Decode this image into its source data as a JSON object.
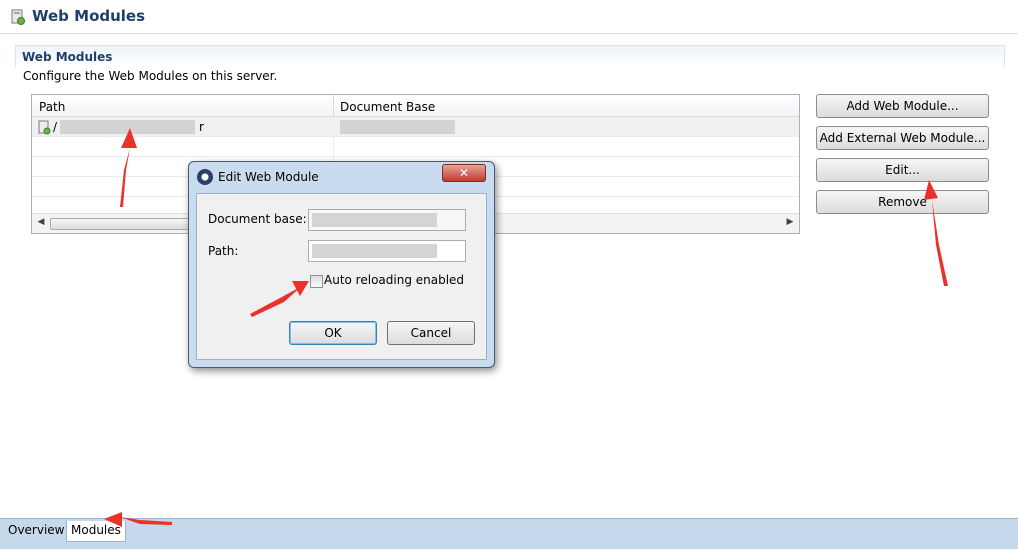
{
  "editor": {
    "title": "Web Modules",
    "icon": "server-icon"
  },
  "section": {
    "title": "Web Modules",
    "description": "Configure the Web Modules on this server."
  },
  "table": {
    "columns": [
      "Path",
      "Document Base"
    ],
    "rows": [
      {
        "path": "/",
        "path_suffix": "r",
        "document_base": "",
        "selected": true
      }
    ]
  },
  "buttons": {
    "add": "Add Web Module...",
    "add_external": "Add External Web Module...",
    "edit": "Edit...",
    "remove": "Remove"
  },
  "tabs": [
    {
      "label": "Overview",
      "active": false
    },
    {
      "label": "Modules",
      "active": true
    }
  ],
  "dialog": {
    "title": "Edit Web Module",
    "icon": "eclipse-icon",
    "close_label": "✕",
    "document_base_label": "Document base:",
    "document_base_value": "",
    "path_label": "Path:",
    "path_value": "",
    "checkbox_label": "Auto reloading enabled",
    "checkbox_checked": false,
    "ok_label": "OK",
    "cancel_label": "Cancel"
  },
  "colors": {
    "annotation_arrow": "#e8322a",
    "accent": "#1f3f6a"
  }
}
